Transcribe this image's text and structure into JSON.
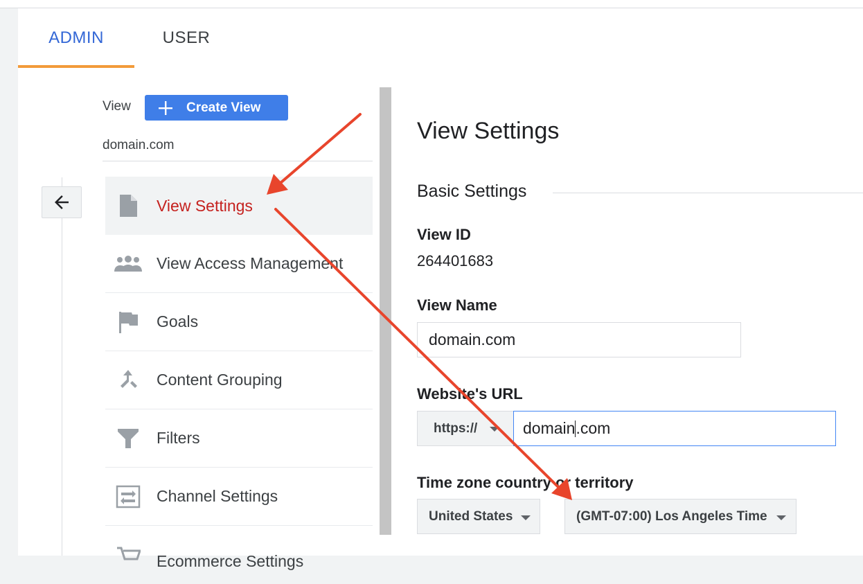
{
  "tabs": {
    "admin": "ADMIN",
    "user": "USER"
  },
  "view_selector": {
    "label": "View",
    "create_button": "Create View",
    "current_view": "domain.com"
  },
  "nav": {
    "items": [
      {
        "label": "View Settings",
        "icon": "document-icon",
        "active": true
      },
      {
        "label": "View Access Management",
        "icon": "people-icon"
      },
      {
        "label": "Goals",
        "icon": "flag-icon"
      },
      {
        "label": "Content Grouping",
        "icon": "content-grouping-icon"
      },
      {
        "label": "Filters",
        "icon": "filter-icon"
      },
      {
        "label": "Channel Settings",
        "icon": "channel-settings-icon"
      },
      {
        "label": "Ecommerce Settings",
        "icon": "cart-icon"
      }
    ]
  },
  "main": {
    "title": "View Settings",
    "section": "Basic Settings",
    "view_id_label": "View ID",
    "view_id": "264401683",
    "view_name_label": "View Name",
    "view_name": "domain.com",
    "url_label": "Website's URL",
    "protocol": "https://",
    "url_before_cursor": "domain",
    "url_after_cursor": ".com",
    "timezone_label": "Time zone country or territory",
    "country": "United States",
    "timezone": "(GMT-07:00) Los Angeles Time"
  },
  "colors": {
    "accent_blue": "#3f7ee8",
    "tab_active": "#3367d6",
    "tab_underline": "#f29b3a",
    "nav_active_text": "#c5221f",
    "annotation_arrow": "#e8452c"
  }
}
